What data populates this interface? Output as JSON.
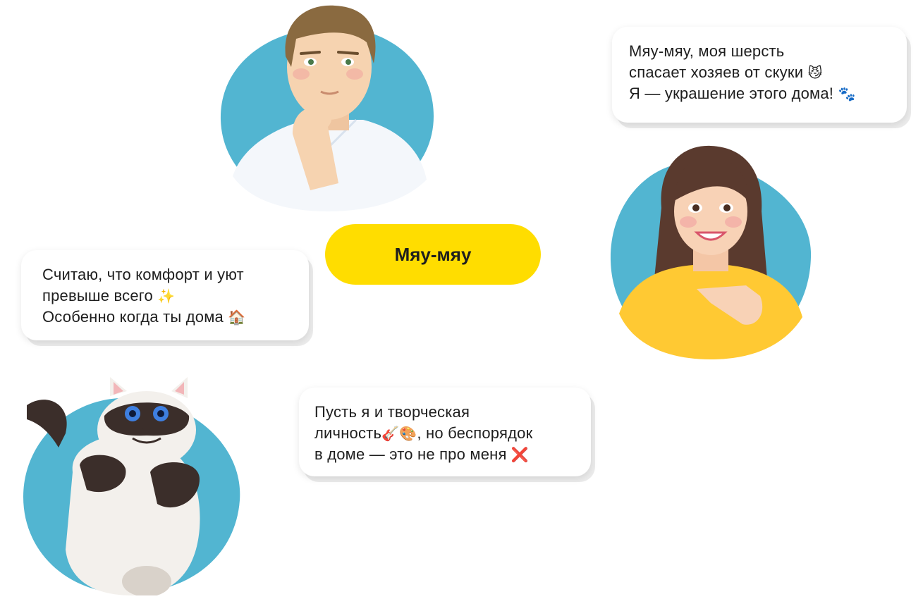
{
  "colors": {
    "blob": "#52B5D1",
    "button": "#FFDD00",
    "text": "#1e1e1e",
    "bubble_bg": "#ffffff"
  },
  "button": {
    "label": "Мяу-мяу"
  },
  "bubble_cat": {
    "line1": "Мяу-мяу, моя шерсть",
    "line2": "спасает хозяев от скуки",
    "line2_emoji": "😼",
    "line3": "Я — украшение этого дома!",
    "line3_emoji": "🐾"
  },
  "bubble_man": {
    "line1": "Считаю, что комфорт и уют",
    "line2": "превыше всего",
    "line2_emoji": "✨",
    "line3": "Особенно когда ты дома",
    "line3_emoji": "🏠"
  },
  "bubble_woman": {
    "line1": "Пусть я и творческая",
    "line2_start": "личность",
    "line2_emoji": "🎸🎨",
    "line2_end": ", но беспорядок",
    "line3": "в доме — это не про меня",
    "line3_emoji": "❌"
  },
  "avatars": {
    "man": "man-avatar",
    "woman": "woman-avatar",
    "cat": "cat-avatar"
  }
}
